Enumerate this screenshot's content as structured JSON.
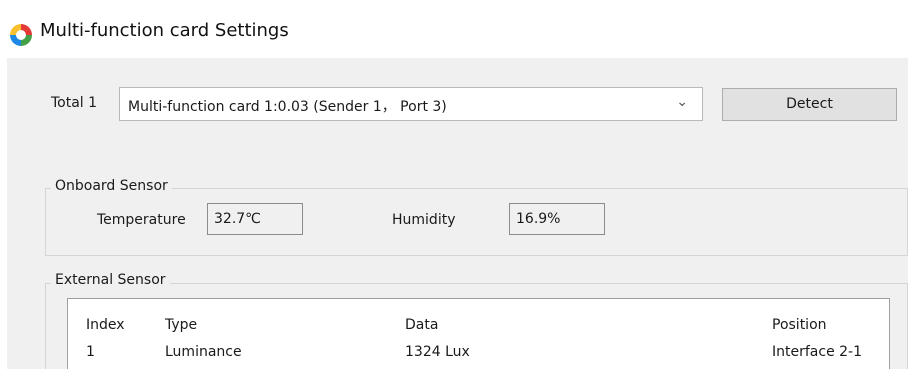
{
  "window": {
    "title": "Multi-function card Settings",
    "icon": "app-color-wheel-icon"
  },
  "device": {
    "total_label": "Total 1",
    "selected_card": "Multi-function card 1:0.03 (Sender 1， Port 3)",
    "detect_label": "Detect"
  },
  "onboard": {
    "legend": "Onboard Sensor",
    "temperature_label": "Temperature",
    "temperature_value": "32.7℃",
    "humidity_label": "Humidity",
    "humidity_value": "16.9%"
  },
  "external": {
    "legend": "External Sensor",
    "columns": [
      "Index",
      "Type",
      "Data",
      "Position"
    ],
    "rows": [
      [
        "1",
        "Luminance",
        "1324 Lux",
        "Interface 2-1"
      ]
    ]
  }
}
